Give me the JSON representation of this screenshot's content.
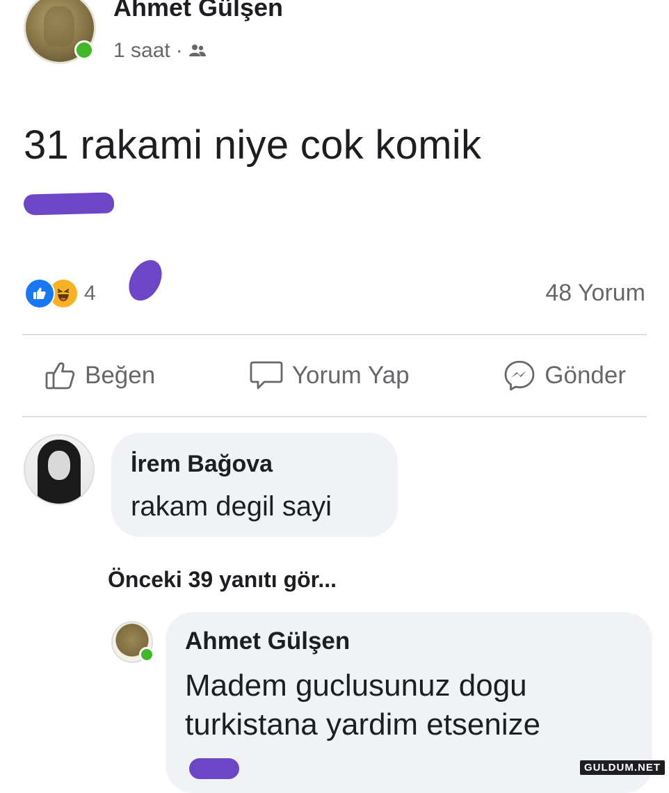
{
  "post": {
    "author": "Ahmet Gülşen",
    "time": "1 saat",
    "separator": "·",
    "audience_icon": "friends-icon",
    "text": "31 rakami niye cok komik",
    "reaction_icons": [
      "like-reaction-icon",
      "haha-reaction-icon"
    ],
    "reaction_count": "4",
    "comment_count": "48 Yorum"
  },
  "actions": {
    "like": "Beğen",
    "comment": "Yorum Yap",
    "send": "Gönder"
  },
  "comments": [
    {
      "author": "İrem Bağova",
      "text": "rakam degil sayi"
    }
  ],
  "previous_replies": "Önceki 39 yanıtı gör...",
  "reply": {
    "author": "Ahmet Gülşen",
    "text": "Madem guclusunuz dogu turkistana yardim etsenize"
  },
  "watermark": "GULDUM.NET",
  "colors": {
    "like_blue": "#1877f2",
    "haha_yellow": "#f7b125",
    "scribble_purple": "#6d46c8",
    "online_green": "#42b72a",
    "bubble_bg": "#f0f2f5",
    "muted_text": "#65676b"
  }
}
